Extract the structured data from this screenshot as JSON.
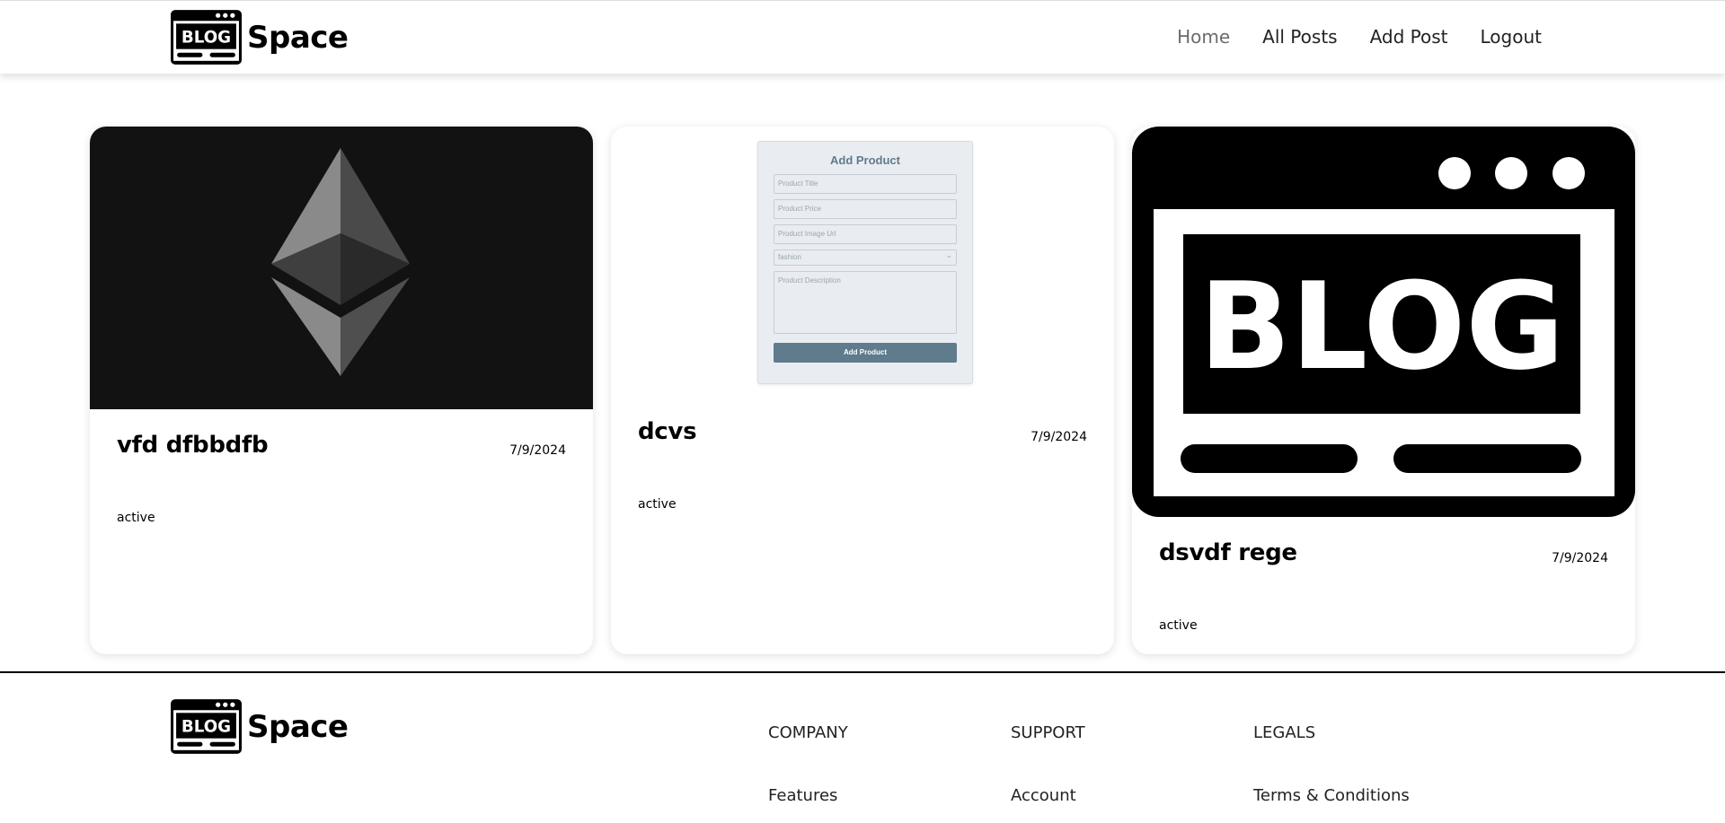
{
  "header": {
    "brand": "Space",
    "nav": [
      "Home",
      "All Posts",
      "Add Post",
      "Logout"
    ]
  },
  "posts": [
    {
      "title": "vfd dfbbdfb",
      "date": "7/9/2024",
      "status": "active",
      "image": "ethereum-logo"
    },
    {
      "title": "dcvs",
      "date": "7/9/2024",
      "status": "active",
      "image": "add-product-form-screenshot"
    },
    {
      "title": "dsvdf rege",
      "date": "7/9/2024",
      "status": "active",
      "image": "blog-logo"
    }
  ],
  "product_form": {
    "heading": "Add Product",
    "title_placeholder": "Product Title",
    "price_placeholder": "Product Price",
    "image_placeholder": "Product Image Url",
    "category": "fashion",
    "description_placeholder": "Product Description",
    "button": "Add Product"
  },
  "logo_text": "BLOG",
  "footer": {
    "brand": "Space",
    "columns": [
      {
        "heading": "COMPANY",
        "link": "Features"
      },
      {
        "heading": "SUPPORT",
        "link": "Account"
      },
      {
        "heading": "LEGALS",
        "link": "Terms & Conditions"
      }
    ]
  },
  "colors": {
    "accent": "#5f7b8c",
    "dark": "#121212"
  }
}
